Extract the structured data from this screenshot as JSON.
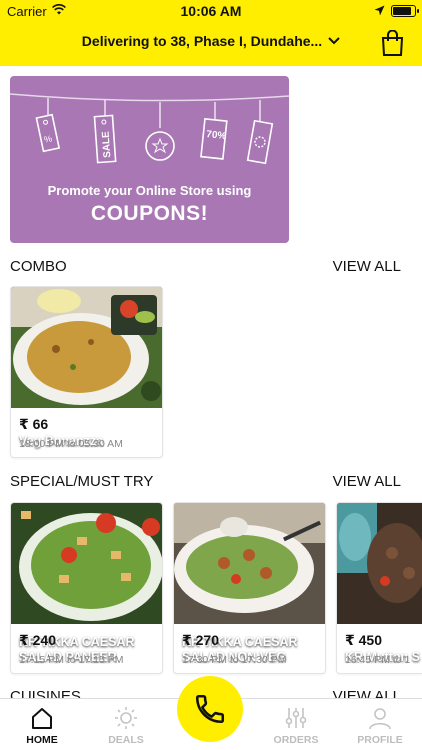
{
  "status_bar": {
    "carrier": "Carrier",
    "time": "10:06 AM",
    "battery_level": 0.9
  },
  "header": {
    "delivery_text": "Delivering to 38, Phase I, Dundahe...",
    "bag_icon": "shopping-bag-icon",
    "color": "#ffee00"
  },
  "banner": {
    "line1": "Promote your Online Store using",
    "line2": "COUPONS!",
    "tag_texts": [
      "SALE",
      "70%"
    ],
    "color": "#a877b4"
  },
  "combo": {
    "title": "COMBO",
    "view_all": "VIEW ALL",
    "items": [
      {
        "name": "Veg Bonanzza",
        "price": "₹ 66",
        "time": "18:00 PM to 05:30 AM"
      }
    ]
  },
  "special": {
    "title": "SPECIAL/MUST TRY",
    "view_all": "VIEW ALL",
    "items": [
      {
        "name": "KR TIKKA CAESAR SALAD PANEER",
        "price": "₹ 240",
        "time": "17:15 PM to 17:15 PM"
      },
      {
        "name": "KR TIKKA CAESAR SALAD NON VEG",
        "price": "₹ 270",
        "time": "17:30 PM to 17:30 PM"
      },
      {
        "name": "KR Mutton S",
        "price": "₹ 450",
        "time": "16:45 PM to 1"
      }
    ]
  },
  "cuisines": {
    "title": "CUISINES",
    "view_all": "VIEW ALL"
  },
  "tabbar": {
    "tabs": [
      {
        "label": "HOME",
        "icon": "home-icon",
        "active": true
      },
      {
        "label": "DEALS",
        "icon": "sun-icon",
        "active": false
      },
      {
        "label": "ORDERS",
        "icon": "sliders-icon",
        "active": false
      },
      {
        "label": "PROFILE",
        "icon": "user-icon",
        "active": false
      }
    ],
    "center_button_icon": "phone-icon",
    "accent": "#ffee00"
  }
}
